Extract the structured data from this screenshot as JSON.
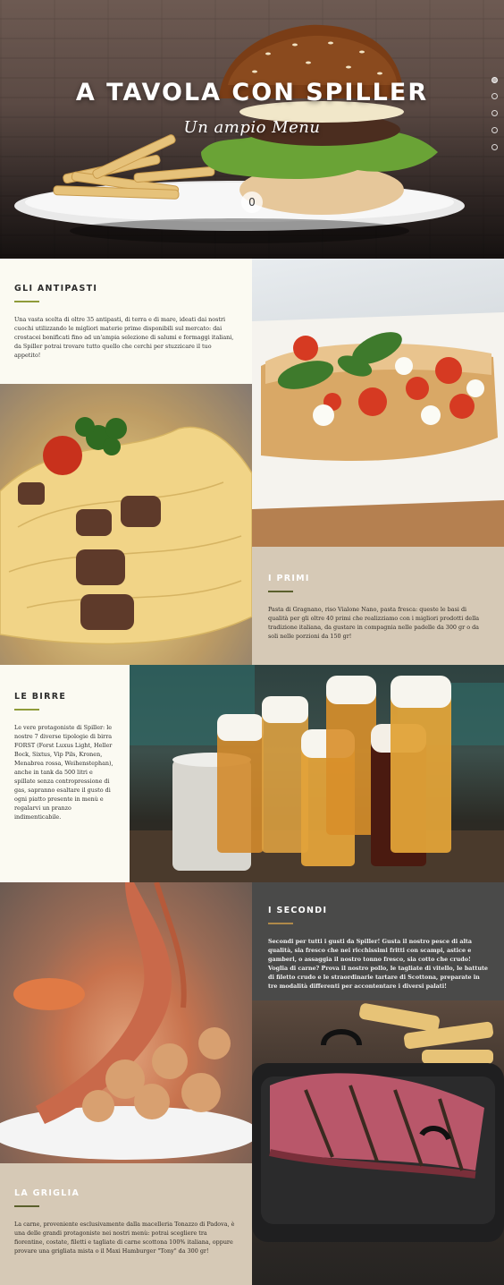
{
  "hero": {
    "title": "A TAVOLA CON SPILLER",
    "subtitle": "Un ampio Menu",
    "badge": "0",
    "nav_dots": 5
  },
  "sections": {
    "antipasti": {
      "title": "GLI ANTIPASTI",
      "body": "Una vasta scelta di oltre 35 antipasti, di terra e di mare, ideati dai nostri cuochi utilizzando le migliori materie prime disponibili sul mercato: dai crostacei bonificati fino ad un'ampia selezione di salumi e formaggi italiani, da Spiller potrai trovare tutto quello che cerchi per stuzzicare il tuo appetito!"
    },
    "primi": {
      "title": "I PRIMI",
      "body": "Pasta di Gragnano, riso Vialone Nano, pasta fresca: queste le basi di qualità per gli oltre 40 primi che realizziamo con i migliori prodotti della tradizione italiana, da gustare in compagnia nelle padelle da 300 gr o da soli nelle porzioni da 150 gr!"
    },
    "birre": {
      "title": "LE BIRRE",
      "body": "Le vere protagoniste di Spiller: le nostre 7 diverse tipologie di birra FORST (Forst Luxus Light, Heller Bock, Sixtus, Vip Pils, Kronen, Menabrea rossa, Weihenstephan), anche in tank da 500 litri e spillate senza contropressione di gas, sapranno esaltare il gusto di ogni piatto presente in menù e regalarvi un pranzo indimenticabile."
    },
    "secondi": {
      "title": "I SECONDI",
      "body": "Secondi per tutti i gusti da Spiller! Gusta il nostro pesce di alta qualità, sia fresco che nei ricchissimi fritti con scampi, astice e gamberi, o assaggia il nostro tonno fresco, sia cotto che crudo! Voglia di carne? Prova il nostro pollo, le tagliate di vitello, le battute di filetto crudo e le straordinarie tartare di Scottona, preparate in tre modalità differenti per accontentare i diversi palati!"
    },
    "griglia": {
      "title": "LA GRIGLIA",
      "body": "La carne, proveniente esclusivamente dalla macelleria Tonazzo di Padova, è una delle grandi protagoniste nei nostri menù: potrai scegliere tra fiorentine, costate, filetti e tagliate di carne scottona 100% italiana, oppure provare una grigliata mista o il Maxi Hamburger \"Tony\" da 300 gr!"
    }
  },
  "images": {
    "hero": "burger-and-fries-photo",
    "bruschetta": "bruschetta-photo",
    "pasta": "pappardelle-photo",
    "beer": "forst-beers-photo",
    "seafood": "fried-seafood-photo",
    "grill": "grilled-steak-photo"
  },
  "colors": {
    "cream": "#fbfaf2",
    "beige": "#d6c9b6",
    "dark": "#4a4a49",
    "olive": "#8f9b3a"
  }
}
